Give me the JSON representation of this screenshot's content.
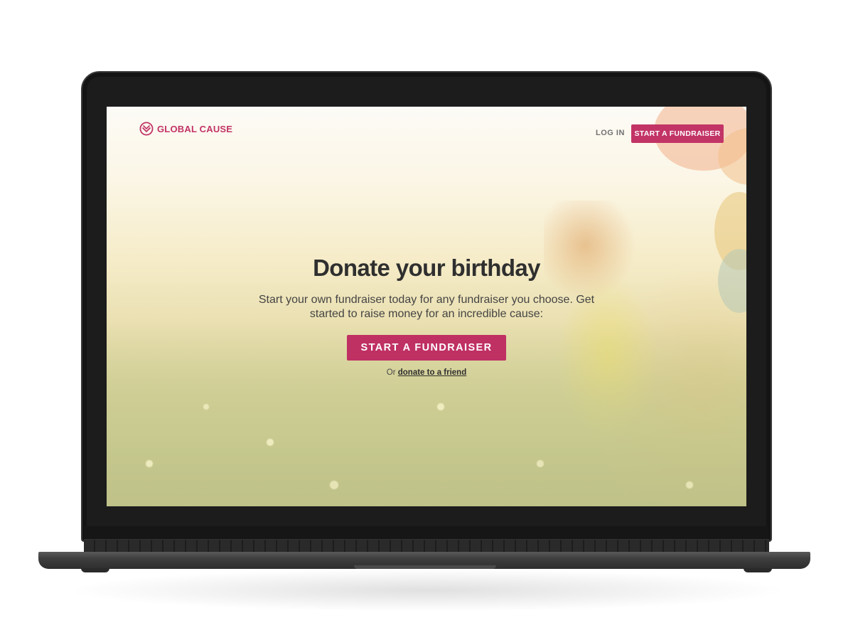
{
  "brand": {
    "name": "GLOBAL CAUSE",
    "logo_icon": "globe-heart-icon",
    "accent_color": "#c23466"
  },
  "nav": {
    "login_label": "LOG IN",
    "cta_label": "START A FUNDRAISER"
  },
  "hero": {
    "title": "Donate your birthday",
    "subtitle": "Start your own fundraiser today for any fundraiser you choose. Get started to raise money for an incredible cause:",
    "cta_label": "START A FUNDRAISER",
    "alt_prefix": "Or",
    "alt_link": "donate to a friend"
  }
}
